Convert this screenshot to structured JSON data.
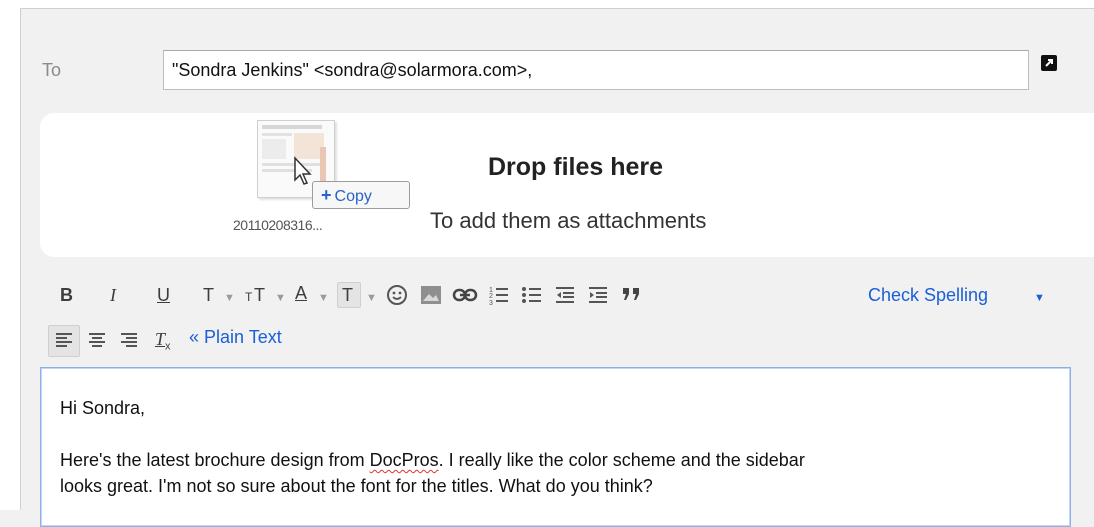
{
  "header": {
    "to_label": "To",
    "to_value": "\"Sondra Jenkins\" <sondra@solarmora.com>,"
  },
  "drop_zone": {
    "title": "Drop files here",
    "subtitle": "To add them as attachments",
    "file_name": "20110208316...",
    "copy_label": "Copy"
  },
  "toolbar": {
    "bold": "B",
    "italic": "I",
    "underline": "U",
    "font": "T",
    "font_size": "T",
    "text_color": "A",
    "highlight": "T",
    "check_spelling": "Check Spelling"
  },
  "toolbar2": {
    "plain_text": "« Plain Text"
  },
  "message": {
    "greeting": "Hi Sondra,",
    "line1_prefix": "Here's the latest brochure design from ",
    "line1_word": "DocPros",
    "line1_suffix": ". I really like the color scheme and the sidebar",
    "line2": "looks great. I'm not so sure about the font for the titles. What do you think?"
  }
}
